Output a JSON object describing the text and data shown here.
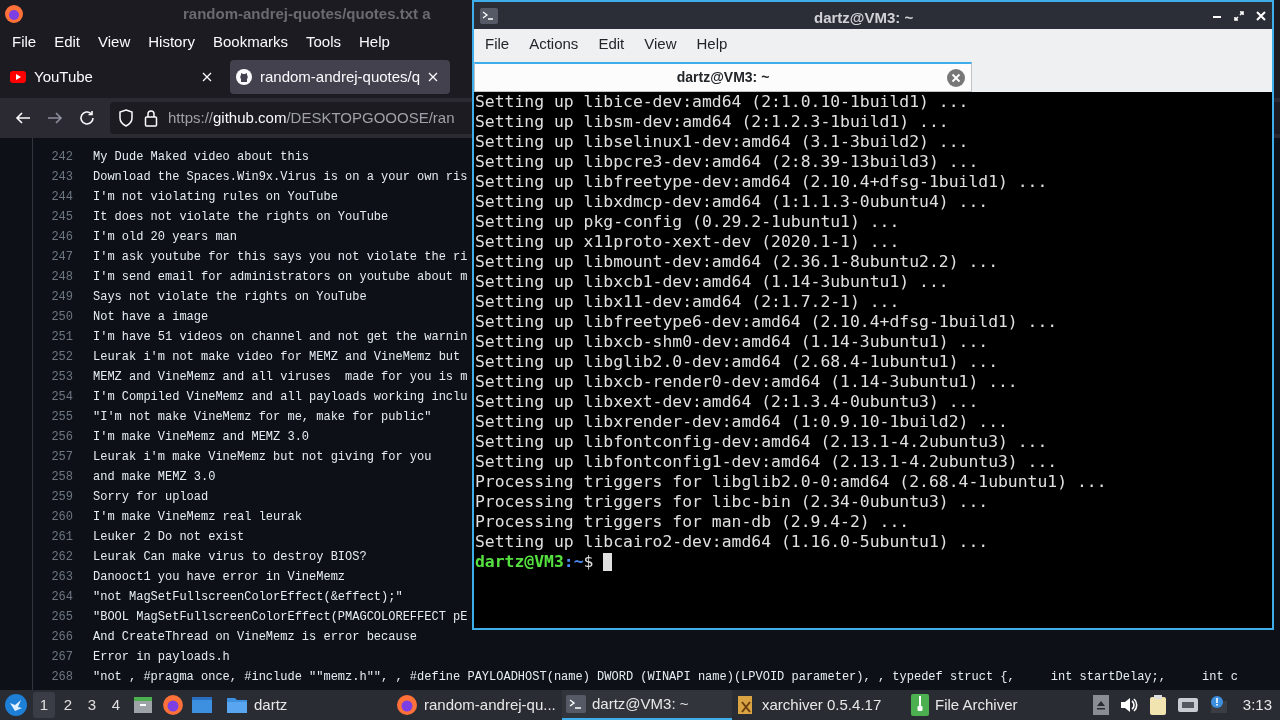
{
  "browser": {
    "title": "random-andrej-quotes/quotes.txt a",
    "menu": [
      "File",
      "Edit",
      "View",
      "History",
      "Bookmarks",
      "Tools",
      "Help"
    ],
    "tabs": [
      {
        "label": "YouTube",
        "kind": "youtube",
        "selected": false
      },
      {
        "label": "random-andrej-quotes/q",
        "kind": "github",
        "selected": true
      }
    ],
    "url": {
      "scheme": "https://",
      "host": "github.com",
      "path": "/DESKTOPGOOOSE/ran"
    },
    "code_lines": [
      {
        "number": "242",
        "text": "My Dude Maked video about this"
      },
      {
        "number": "243",
        "text": "Download the Spaces.Win9x.Virus is on a your own ris"
      },
      {
        "number": "244",
        "text": "I'm not violating rules on YouTube"
      },
      {
        "number": "245",
        "text": "It does not violate the rights on YouTube"
      },
      {
        "number": "246",
        "text": "I'm old 20 years man"
      },
      {
        "number": "247",
        "text": "I'm ask youtube for this says you not violate the ri"
      },
      {
        "number": "248",
        "text": "I'm send email for administrators on youtube about m"
      },
      {
        "number": "249",
        "text": "Says not violate the rights on YouTube"
      },
      {
        "number": "250",
        "text": "Not have a image"
      },
      {
        "number": "251",
        "text": "I'm have 51 videos on channel and not get the warnin"
      },
      {
        "number": "252",
        "text": "Leurak i'm not make video for MEMZ and VineMemz but"
      },
      {
        "number": "253",
        "text": "MEMZ and VineMemz and all viruses  made for you is m"
      },
      {
        "number": "254",
        "text": "I'm Compiled VineMemz and all payloads working inclu"
      },
      {
        "number": "255",
        "text": "\"I'm not make VineMemz for me, make for public\""
      },
      {
        "number": "256",
        "text": "I'm make VineMemz and MEMZ 3.0"
      },
      {
        "number": "257",
        "text": "Leurak i'm make VineMemz but not giving for you"
      },
      {
        "number": "258",
        "text": "and make MEMZ 3.0"
      },
      {
        "number": "259",
        "text": "Sorry for upload"
      },
      {
        "number": "260",
        "text": "I'm make VineMemz real leurak"
      },
      {
        "number": "261",
        "text": "Leuker 2 Do not exist"
      },
      {
        "number": "262",
        "text": "Leurak Can make virus to destroy BIOS?"
      },
      {
        "number": "263",
        "text": "Danooct1 you have error in VineMemz"
      },
      {
        "number": "264",
        "text": "\"not MagSetFullscreenColorEffect(&effect);\""
      },
      {
        "number": "265",
        "text": "\"BOOL MagSetFullscreenColorEffect(PMAGCOLOREFFECT pE"
      },
      {
        "number": "266",
        "text": "And CreateThread on VineMemz is error because"
      },
      {
        "number": "267",
        "text": "Error in payloads.h"
      },
      {
        "number": "268",
        "text": "\"not , #pragma once, #include \"\"memz.h\"\", , #define PAYLOADHOST(name) DWORD (WINAPI name)(LPVOID parameter), , typedef struct {,     int startDelay;,     int c"
      }
    ]
  },
  "terminal": {
    "title": "dartz@VM3: ~",
    "menu": [
      "File",
      "Actions",
      "Edit",
      "View",
      "Help"
    ],
    "tab": {
      "label": "dartz@VM3: ~"
    },
    "lines": [
      "Setting up libice-dev:amd64 (2:1.0.10-1build1) ...",
      "Setting up libsm-dev:amd64 (2:1.2.3-1build1) ...",
      "Setting up libselinux1-dev:amd64 (3.1-3build2) ...",
      "Setting up libpcre3-dev:amd64 (2:8.39-13build3) ...",
      "Setting up libfreetype-dev:amd64 (2.10.4+dfsg-1build1) ...",
      "Setting up libxdmcp-dev:amd64 (1:1.1.3-0ubuntu4) ...",
      "Setting up pkg-config (0.29.2-1ubuntu1) ...",
      "Setting up x11proto-xext-dev (2020.1-1) ...",
      "Setting up libmount-dev:amd64 (2.36.1-8ubuntu2.2) ...",
      "Setting up libxcb1-dev:amd64 (1.14-3ubuntu1) ...",
      "Setting up libx11-dev:amd64 (2:1.7.2-1) ...",
      "Setting up libfreetype6-dev:amd64 (2.10.4+dfsg-1build1) ...",
      "Setting up libxcb-shm0-dev:amd64 (1.14-3ubuntu1) ...",
      "Setting up libglib2.0-dev:amd64 (2.68.4-1ubuntu1) ...",
      "Setting up libxcb-render0-dev:amd64 (1.14-3ubuntu1) ...",
      "Setting up libxext-dev:amd64 (2:1.3.4-0ubuntu3) ...",
      "Setting up libxrender-dev:amd64 (1:0.9.10-1build2) ...",
      "Setting up libfontconfig-dev:amd64 (2.13.1-4.2ubuntu3) ...",
      "Setting up libfontconfig1-dev:amd64 (2.13.1-4.2ubuntu3) ...",
      "Processing triggers for libglib2.0-0:amd64 (2.68.4-1ubuntu1) ...",
      "Processing triggers for libc-bin (2.34-0ubuntu3) ...",
      "Processing triggers for man-db (2.9.4-2) ...",
      "Setting up libcairo2-dev:amd64 (1.16.0-5ubuntu1) ..."
    ],
    "prompt": {
      "user_host": "dartz@VM3",
      "path": ":~",
      "symbol": "$"
    }
  },
  "taskbar": {
    "workspaces": [
      {
        "label": "1",
        "selected": true
      },
      {
        "label": "2",
        "selected": false
      },
      {
        "label": "3",
        "selected": false
      },
      {
        "label": "4",
        "selected": false
      }
    ],
    "tasks": [
      {
        "label": "dartz",
        "kind": "folder",
        "selected": false
      },
      {
        "label": "random-andrej-qu...",
        "kind": "firefox",
        "selected": false
      },
      {
        "label": "dartz@VM3: ~",
        "kind": "terminal",
        "selected": true
      },
      {
        "label": "xarchiver 0.5.4.17",
        "kind": "xarchiver",
        "selected": false
      },
      {
        "label": "File Archiver",
        "kind": "archiver",
        "selected": false
      }
    ],
    "clock": "3:13"
  }
}
